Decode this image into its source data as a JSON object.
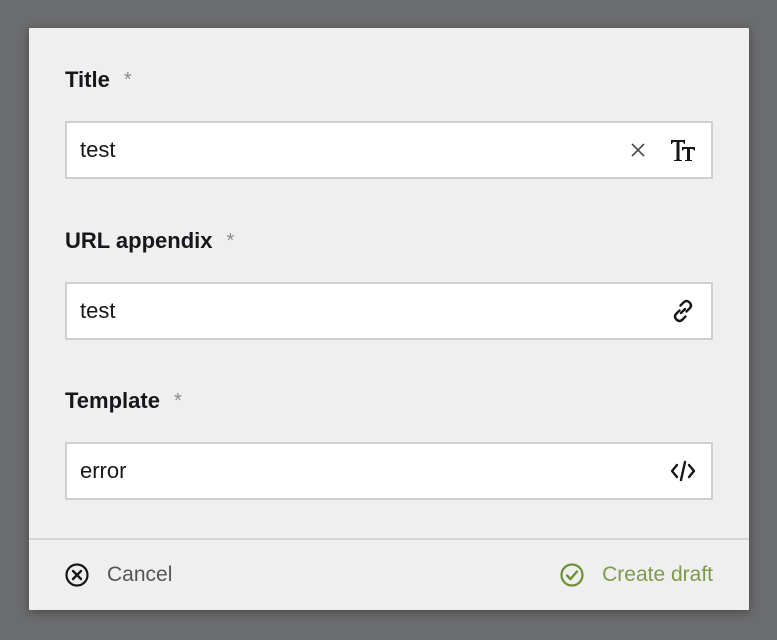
{
  "dialog": {
    "fields": [
      {
        "label": "Title",
        "required_mark": "*",
        "value": "test",
        "icon": "text-size-icon",
        "has_clear": true,
        "clear_icon": "close-icon"
      },
      {
        "label": "URL appendix",
        "required_mark": "*",
        "value": "test",
        "icon": "link-icon",
        "has_clear": false
      },
      {
        "label": "Template",
        "required_mark": "*",
        "value": "error",
        "icon": "code-icon",
        "has_clear": false
      }
    ],
    "footer": {
      "cancel_label": "Cancel",
      "cancel_icon": "cancel-circle-icon",
      "create_label": "Create draft",
      "create_icon": "check-circle-icon"
    }
  },
  "colors": {
    "backdrop": "#6b6c6e",
    "dialog_bg": "#efefef",
    "positive": "#7e9a4b",
    "text": "#16171a"
  }
}
